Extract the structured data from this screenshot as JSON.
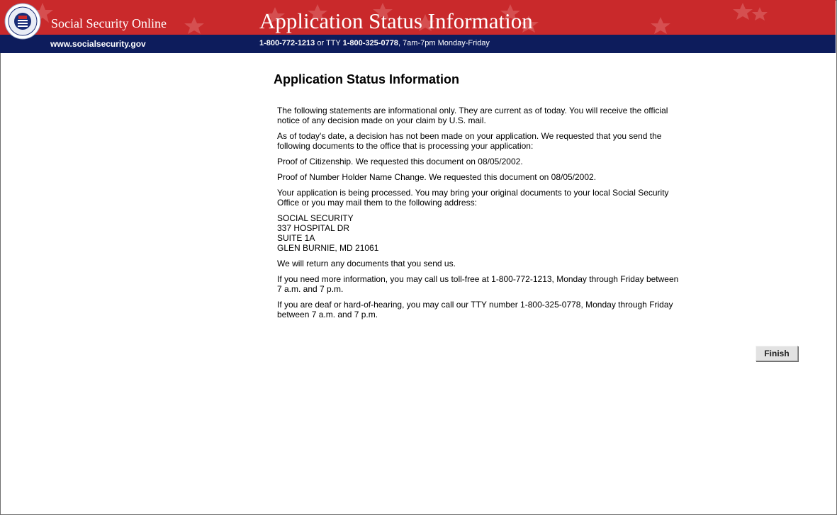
{
  "header": {
    "site_name": "Social Security Online",
    "title": "Application Status Information",
    "url": "www.socialsecurity.gov",
    "phone": "1-800-772-1213",
    "or_tty": "or TTY",
    "tty": "1-800-325-0778",
    "hours": ", 7am-7pm Monday-Friday",
    "seal_text": "SOCIAL SECURITY ADMINISTRATION USA",
    "colors": {
      "banner_red": "#c9292b",
      "subbar_blue": "#0d1c5c"
    }
  },
  "main": {
    "heading": "Application Status Information",
    "paragraphs": {
      "p1": "The following statements are informational only. They are current as of today. You will receive the official notice of any decision made on your claim by U.S. mail.",
      "p2": "As of today's date, a decision has not been made on your application. We requested that you send the following documents to the office that is processing your application:",
      "p3": "Proof of Citizenship. We requested this document on 08/05/2002.",
      "p4": "Proof of Number Holder Name Change. We requested this document on 08/05/2002.",
      "p5": "Your application is being processed. You may bring your original documents to your local Social Security Office or you may mail them to the following address:",
      "p6": "We will return any documents that you send us.",
      "p7": "If you need more information, you may call us toll-free at 1-800-772-1213, Monday through Friday between 7 a.m. and 7 p.m.",
      "p8": "If you are deaf or hard-of-hearing, you may call our TTY number 1-800-325-0778, Monday through Friday between 7 a.m. and 7 p.m."
    },
    "address": {
      "line1": "SOCIAL SECURITY",
      "line2": "337 HOSPITAL DR",
      "line3": "SUITE 1A",
      "line4": "GLEN BURNIE, MD 21061"
    }
  },
  "actions": {
    "finish_label": "Finish"
  }
}
